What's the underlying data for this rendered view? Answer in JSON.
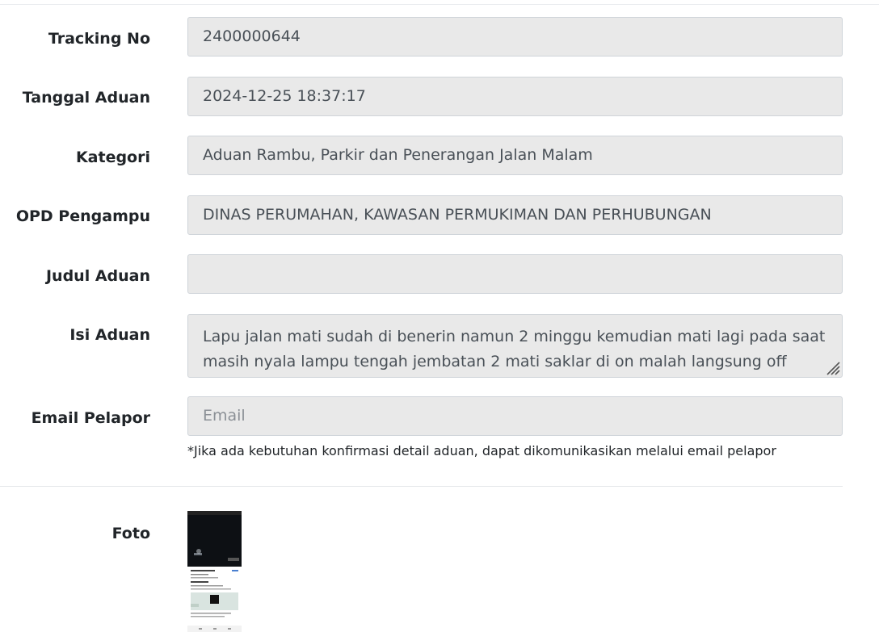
{
  "form": {
    "tracking_no": {
      "label": "Tracking No",
      "value": "2400000644"
    },
    "tanggal_aduan": {
      "label": "Tanggal Aduan",
      "value": "2024-12-25 18:37:17"
    },
    "kategori": {
      "label": "Kategori",
      "value": "Aduan Rambu, Parkir dan Penerangan Jalan Malam"
    },
    "opd_pengampu": {
      "label": "OPD Pengampu",
      "value": "DINAS PERUMAHAN, KAWASAN PERMUKIMAN DAN PERHUBUNGAN"
    },
    "judul_aduan": {
      "label": "Judul Aduan",
      "value": ""
    },
    "isi_aduan": {
      "label": "Isi Aduan",
      "value": "Lapu jalan mati sudah di benerin namun 2 minggu kemudian mati lagi pada saat masih nyala lampu tengah jembatan 2 mati saklar di on malah langsung off seperti"
    },
    "email_pelapor": {
      "label": "Email Pelapor",
      "value": "",
      "placeholder": "Email",
      "help": "*Jika ada kebutuhan konfirmasi detail aduan, dapat dikomunikasikan melalui email pelapor"
    },
    "foto": {
      "label": "Foto"
    }
  },
  "colors": {
    "field_bg": "#e9e9e9",
    "field_border": "#cfd4d9",
    "label_text": "#212529",
    "field_text": "#495057",
    "placeholder_text": "#8b9096"
  },
  "icons": {
    "textarea_resize": "resize-handle-icon"
  }
}
